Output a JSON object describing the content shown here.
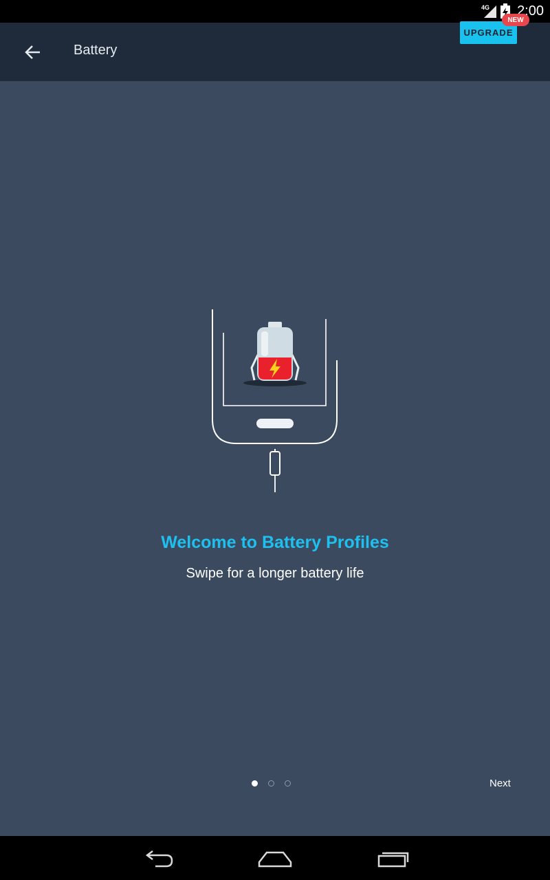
{
  "status_bar": {
    "network_label": "4G",
    "time": "2:00",
    "icons": [
      "signal-icon",
      "battery-charging-icon"
    ]
  },
  "app_bar": {
    "back_icon": "arrow-back-icon",
    "title": "Battery",
    "upgrade_label": "UPGRADE",
    "new_badge": "NEW"
  },
  "onboarding": {
    "illustration": "phone-charging-battery-icon",
    "headline": "Welcome to Battery Profiles",
    "subline": "Swipe for a longer battery life",
    "page_indicator": {
      "current": 1,
      "total": 3
    },
    "next_label": "Next"
  },
  "nav_bar": {
    "icons": [
      "back-nav-icon",
      "home-nav-icon",
      "recents-nav-icon"
    ]
  },
  "colors": {
    "background": "#3b4a5f",
    "app_bar": "#1f2b3a",
    "accent": "#1ec0ef",
    "upgrade_button": "#18c1ee",
    "badge": "#e8484d"
  }
}
